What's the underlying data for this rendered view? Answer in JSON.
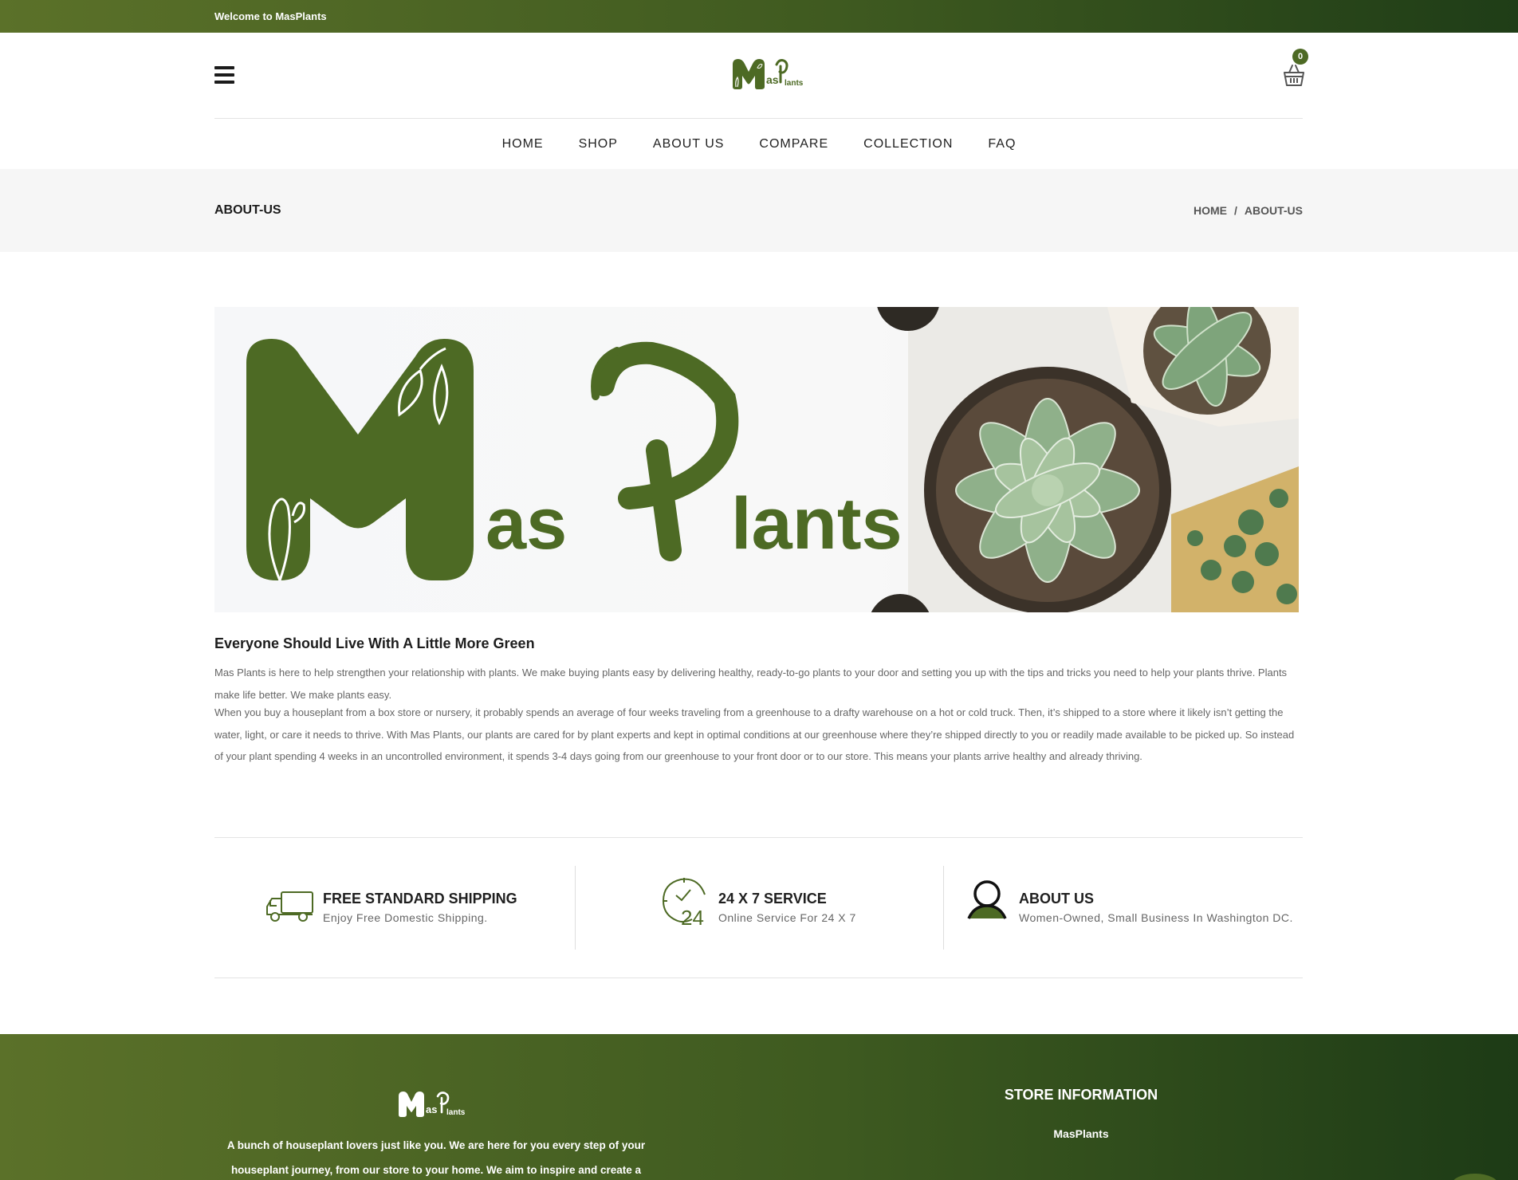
{
  "topbar": {
    "welcome": "Welcome to MasPlants"
  },
  "header": {
    "logo_text_m": "M",
    "logo_text_as": "as",
    "logo_text_p": "P",
    "logo_text_lants": "lants",
    "cart_count": "0"
  },
  "nav": {
    "items": [
      {
        "label": "HOME"
      },
      {
        "label": "SHOP"
      },
      {
        "label": "ABOUT US"
      },
      {
        "label": "COMPARE"
      },
      {
        "label": "COLLECTION"
      },
      {
        "label": "FAQ"
      }
    ]
  },
  "pagebar": {
    "title": "ABOUT-US",
    "breadcrumb": {
      "home": "HOME",
      "separator": "/",
      "current": "ABOUT-US"
    }
  },
  "banner": {
    "word_as": "as",
    "word_lants": "lants"
  },
  "content": {
    "title": "Everyone Should Live With A Little More Green",
    "paragraph1": "Mas Plants is here to help strengthen your relationship with plants. We make buying plants easy by delivering healthy, ready-to-go plants to your door and setting you up with the tips and tricks you need to help your plants thrive. Plants make life better. We make plants easy.",
    "paragraph2": "When you buy a houseplant from a box store or nursery, it probably spends an average of four weeks traveling from a greenhouse to a drafty warehouse on a hot or cold truck. Then, it’s shipped to a store where it likely isn’t getting the water, light, or care it needs to thrive. With Mas Plants, our plants are cared for by plant experts and kept in optimal conditions at our greenhouse where they’re shipped directly to you or readily made available to be picked up. So instead of your plant spending 4 weeks in an uncontrolled environment, it spends 3-4 days going from our greenhouse to your front door or to our store. This means your plants arrive healthy and already thriving."
  },
  "features": [
    {
      "icon": "truck-icon",
      "title": "FREE STANDARD SHIPPING",
      "subtitle": "Enjoy Free Domestic Shipping."
    },
    {
      "icon": "clock-24-icon",
      "title": "24 X 7 SERVICE",
      "subtitle": "Online Service For 24 X 7"
    },
    {
      "icon": "user-icon",
      "title": "ABOUT US",
      "subtitle": "Women-Owned, Small Business In Washington DC."
    }
  ],
  "footer": {
    "about_text": "A bunch of houseplant lovers just like you. We are here for you every step of your houseplant journey, from our store to your home. We aim to inspire and create a",
    "store_title": "STORE INFORMATION",
    "store_name": "MasPlants"
  },
  "colors": {
    "brand_green": "#4d6a24",
    "dark_green": "#1f3d17",
    "text_gray": "#666666"
  }
}
